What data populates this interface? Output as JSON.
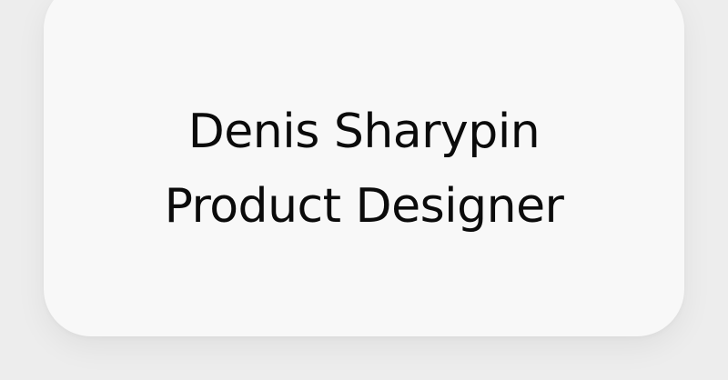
{
  "card": {
    "name": "Denis Sharypin",
    "role": "Product Designer"
  },
  "colors": {
    "background": "#ededed",
    "card": "#f8f8f8",
    "text": "#0b0b0b"
  }
}
